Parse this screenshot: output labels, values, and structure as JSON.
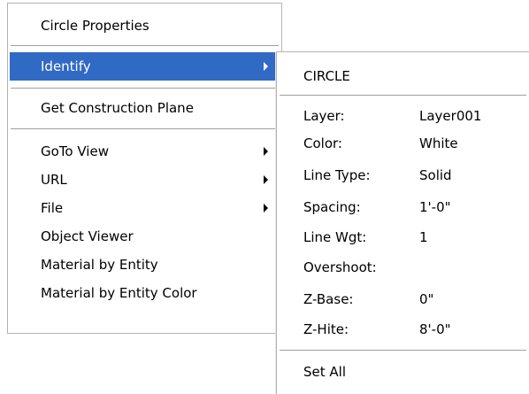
{
  "context_menu": {
    "items": [
      {
        "label": "Circle Properties"
      },
      {
        "label": "Identify"
      },
      {
        "label": "Get Construction Plane"
      },
      {
        "label": "GoTo View"
      },
      {
        "label": "URL"
      },
      {
        "label": "File"
      },
      {
        "label": "Object Viewer"
      },
      {
        "label": "Material by Entity"
      },
      {
        "label": "Material by Entity Color"
      }
    ],
    "highlight_color": "#316ac5"
  },
  "identify_submenu": {
    "entity_type": "CIRCLE",
    "properties": [
      {
        "key": "Layer:",
        "value": "Layer001"
      },
      {
        "key": "Color:",
        "value": "White"
      },
      {
        "key": "Line Type:",
        "value": "Solid"
      },
      {
        "key": "Spacing:",
        "value": "1'-0\""
      },
      {
        "key": "Line Wgt:",
        "value": "1"
      },
      {
        "key": "Overshoot:",
        "value": ""
      },
      {
        "key": "Z-Base:",
        "value": "0\""
      },
      {
        "key": "Z-Hite:",
        "value": "8'-0\""
      }
    ],
    "set_all_label": "Set All"
  }
}
